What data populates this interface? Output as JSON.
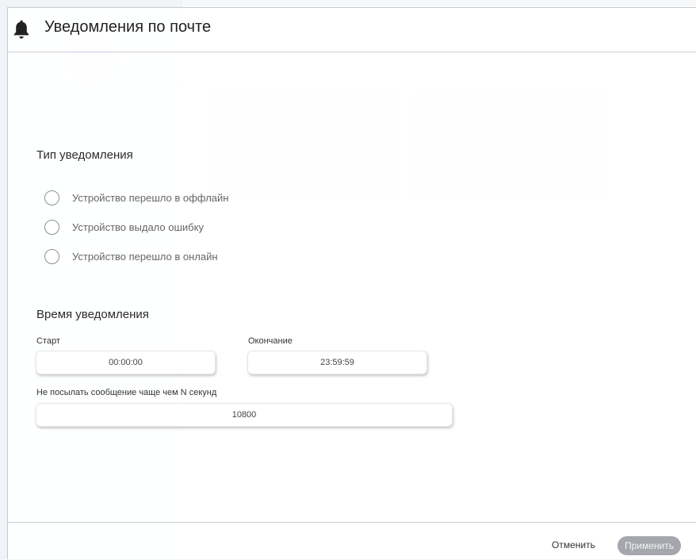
{
  "modal": {
    "title": "Уведомления по почте",
    "icon": "bell-icon"
  },
  "notification_type": {
    "title": "Тип уведомления",
    "options": [
      {
        "label": "Устройство перешло в оффлайн",
        "checked": false
      },
      {
        "label": "Устройство выдало ошибку",
        "checked": false
      },
      {
        "label": "Устройство перешло в онлайн",
        "checked": false
      }
    ]
  },
  "notification_time": {
    "title": "Время уведомления",
    "start_label": "Старт",
    "start_value": "00:00:00",
    "end_label": "Окончание",
    "end_value": "23:59:59",
    "interval_label": "Не посылать сообщение чаще чем N секунд",
    "interval_value": "10800"
  },
  "footer": {
    "cancel_label": "Отменить",
    "apply_label": "Применить"
  },
  "colors": {
    "apply_button_bg": "#a5a7ad",
    "divider": "#c9ccd8",
    "bell": "#222222"
  }
}
